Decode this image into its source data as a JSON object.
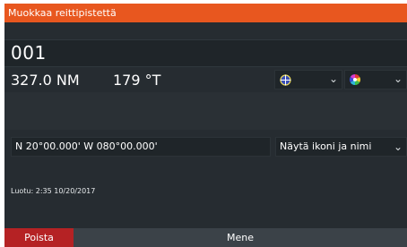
{
  "dialog": {
    "title": "Muokkaa reittipistettä"
  },
  "waypoint": {
    "name": "001",
    "distance": "327.0 NM",
    "bearing": "179 °T",
    "symbol_icon": "waypoint-crosshair-icon",
    "color_icon": "color-wheel-icon",
    "position": "N 20°00.000'   W 080°00.000'",
    "display_mode": "Näytä ikoni ja nimi",
    "created": "Luotu: 2:35   10/20/2017"
  },
  "buttons": {
    "delete": "Poista",
    "go": "Mene"
  },
  "colors": {
    "title_bar": "#e8571f",
    "delete_button": "#b52224",
    "background": "#262c31"
  }
}
